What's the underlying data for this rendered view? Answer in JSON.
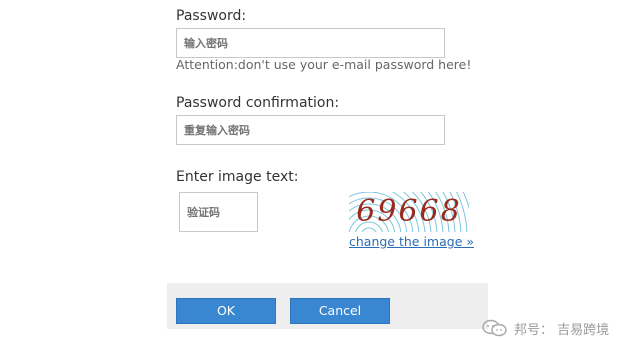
{
  "password": {
    "label": "Password:",
    "placeholder": "输入密码",
    "hint": "Attention:don't use your e-mail password here!"
  },
  "password_confirmation": {
    "label": "Password confirmation:",
    "placeholder": "重复输入密码"
  },
  "captcha": {
    "label": "Enter image text:",
    "placeholder": "验证码",
    "image_text": "69668",
    "change_link": "change the image »"
  },
  "buttons": {
    "ok": "OK",
    "cancel": "Cancel",
    "color": "#3a87d1"
  },
  "watermark": {
    "text": "邦号： 吉易跨境",
    "icon": "wechat-icon"
  }
}
